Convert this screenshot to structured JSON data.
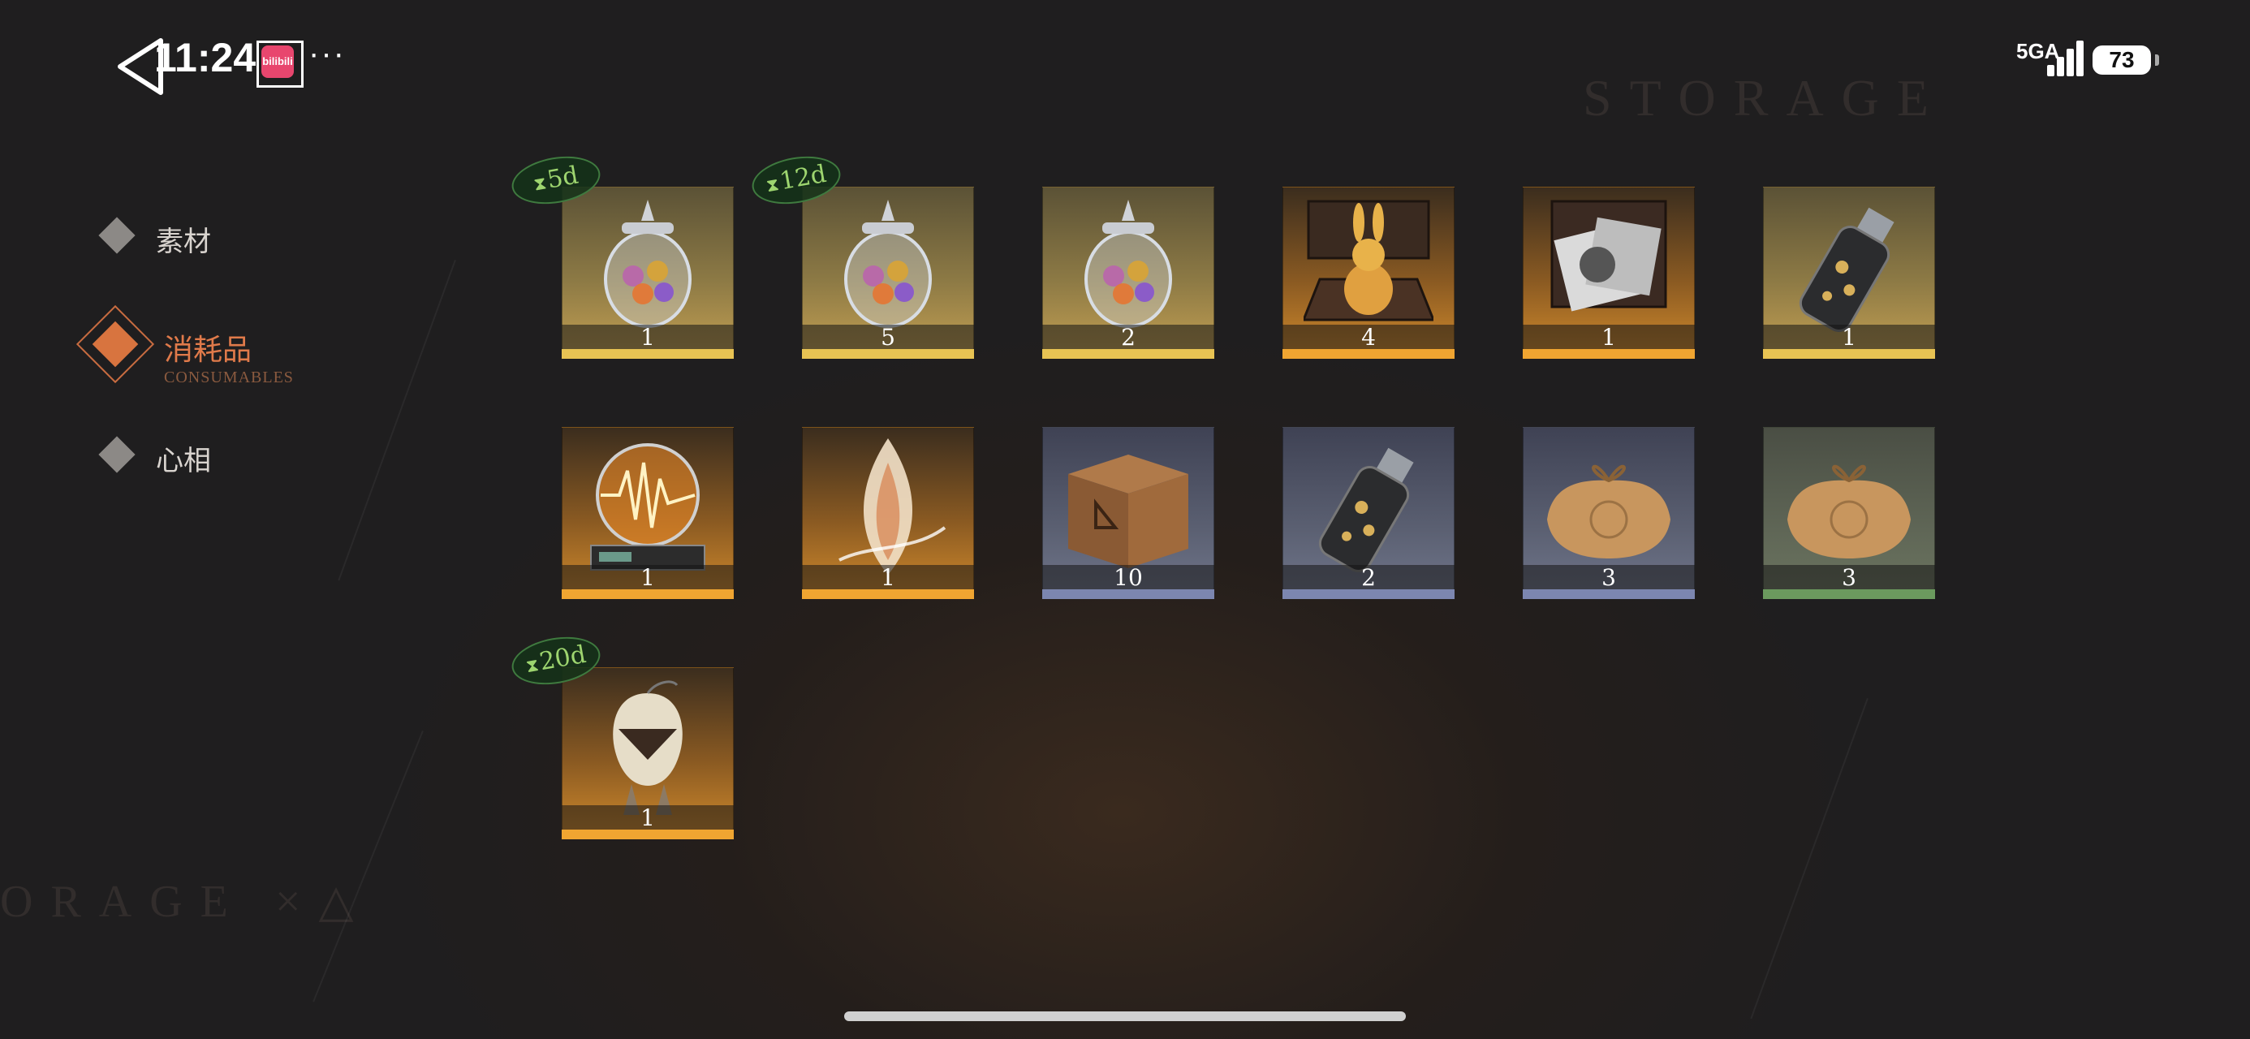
{
  "status": {
    "time": "11:24",
    "app_badge": "bilibili",
    "more": "···",
    "network": "5GA",
    "battery": "73"
  },
  "background": {
    "top_word": "STORAGE",
    "bottom_word": "ORAGE ×△"
  },
  "sidebar": {
    "items": [
      {
        "label": "素材",
        "sub": "",
        "active": false
      },
      {
        "label": "消耗品",
        "sub": "CONSUMABLES",
        "active": true
      },
      {
        "label": "心相",
        "sub": "",
        "active": false
      }
    ]
  },
  "inventory": {
    "items": [
      {
        "name": "candy-jar",
        "icon": "candy-jar-icon",
        "count": "1",
        "rarity": "gold",
        "timer": "5d"
      },
      {
        "name": "candy-jar",
        "icon": "candy-jar-icon",
        "count": "5",
        "rarity": "gold",
        "timer": "12d"
      },
      {
        "name": "candy-jar",
        "icon": "candy-jar-icon",
        "count": "2",
        "rarity": "gold",
        "timer": ""
      },
      {
        "name": "rabbit-figure-box",
        "icon": "rabbit-box-icon",
        "count": "4",
        "rarity": "orange",
        "timer": ""
      },
      {
        "name": "photo-box",
        "icon": "photo-box-icon",
        "count": "1",
        "rarity": "orange",
        "timer": ""
      },
      {
        "name": "bottle",
        "icon": "bottle-icon",
        "count": "1",
        "rarity": "gold",
        "timer": ""
      },
      {
        "name": "radio-globe",
        "icon": "radio-globe-icon",
        "count": "1",
        "rarity": "orange",
        "timer": ""
      },
      {
        "name": "spirit-flame",
        "icon": "spirit-flame-icon",
        "count": "1",
        "rarity": "orange",
        "timer": ""
      },
      {
        "name": "wooden-crate",
        "icon": "wooden-crate-icon",
        "count": "10",
        "rarity": "blue",
        "timer": ""
      },
      {
        "name": "bottle",
        "icon": "bottle-icon",
        "count": "2",
        "rarity": "blue",
        "timer": ""
      },
      {
        "name": "parcel",
        "icon": "parcel-icon",
        "count": "3",
        "rarity": "blue",
        "timer": ""
      },
      {
        "name": "parcel",
        "icon": "parcel-icon",
        "count": "3",
        "rarity": "green",
        "timer": ""
      },
      {
        "name": "pouch-charm",
        "icon": "pouch-charm-icon",
        "count": "1",
        "rarity": "orange",
        "timer": "20d"
      }
    ]
  }
}
